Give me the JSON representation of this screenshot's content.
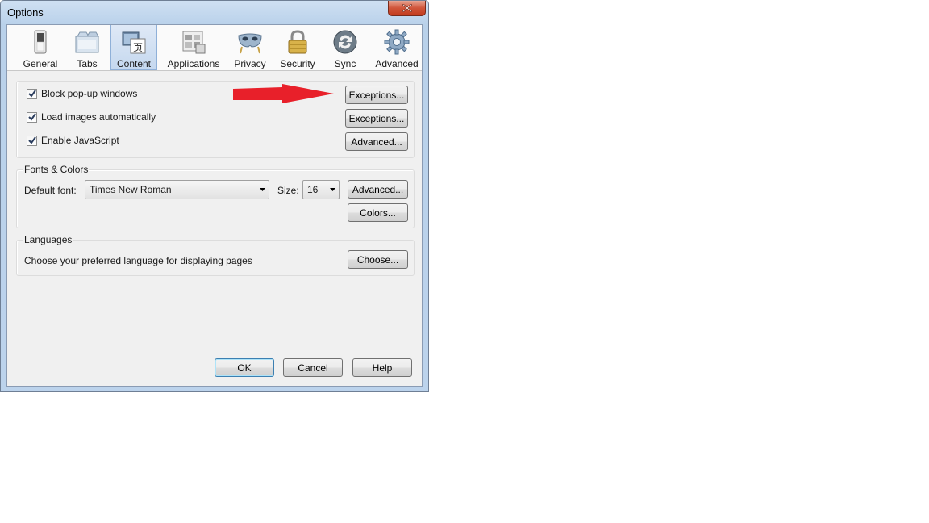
{
  "window": {
    "title": "Options"
  },
  "toolbar": {
    "tabs": [
      {
        "label": "General",
        "icon": "switch-icon"
      },
      {
        "label": "Tabs",
        "icon": "tabs-icon"
      },
      {
        "label": "Content",
        "icon": "content-icon",
        "selected": true
      },
      {
        "label": "Applications",
        "icon": "applications-icon"
      },
      {
        "label": "Privacy",
        "icon": "mask-icon"
      },
      {
        "label": "Security",
        "icon": "padlock-icon"
      },
      {
        "label": "Sync",
        "icon": "sync-icon"
      },
      {
        "label": "Advanced",
        "icon": "gear-icon"
      }
    ]
  },
  "content": {
    "block_popups": {
      "label": "Block pop-up windows",
      "checked": true,
      "button": "Exceptions..."
    },
    "load_images": {
      "label": "Load images automatically",
      "checked": true,
      "button": "Exceptions..."
    },
    "javascript": {
      "label": "Enable JavaScript",
      "checked": true,
      "button": "Advanced..."
    }
  },
  "fonts": {
    "title": "Fonts & Colors",
    "default_font_label": "Default font:",
    "default_font_value": "Times New Roman",
    "size_label": "Size:",
    "size_value": "16",
    "advanced_button": "Advanced...",
    "colors_button": "Colors..."
  },
  "languages": {
    "title": "Languages",
    "description": "Choose your preferred language for displaying pages",
    "choose_button": "Choose..."
  },
  "footer": {
    "ok": "OK",
    "cancel": "Cancel",
    "help": "Help"
  },
  "annotation": {
    "arrow_color": "#e8202a"
  },
  "colors": {
    "accent": "#3c7fb1",
    "frame": "#bcd3ec",
    "close": "#c23a1d"
  }
}
